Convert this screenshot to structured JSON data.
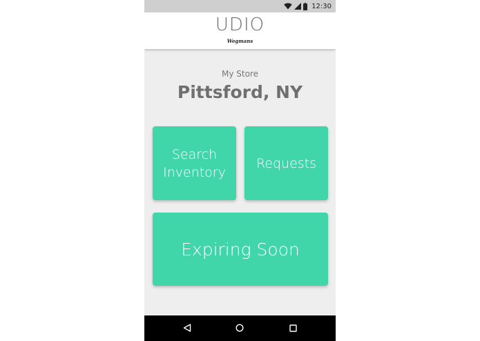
{
  "status_bar": {
    "time": "12:30",
    "icons": [
      "wifi-icon",
      "cell-signal-icon",
      "battery-icon"
    ]
  },
  "app_bar": {
    "title": "UDIO",
    "brand": "Wegmans"
  },
  "store": {
    "label": "My Store",
    "name": "Pittsford, NY"
  },
  "tiles": {
    "search_inventory": "Search Inventory",
    "requests": "Requests",
    "expiring_soon": "Expiring Soon"
  },
  "nav_bar": {
    "icons": [
      "back-icon",
      "home-icon",
      "recents-icon"
    ]
  },
  "colors": {
    "accent": "#40d6a9",
    "background": "#eeeeee",
    "status_bar": "#cfcfcf",
    "nav_bar": "#000000",
    "text_gray": "#6f6f6f"
  }
}
